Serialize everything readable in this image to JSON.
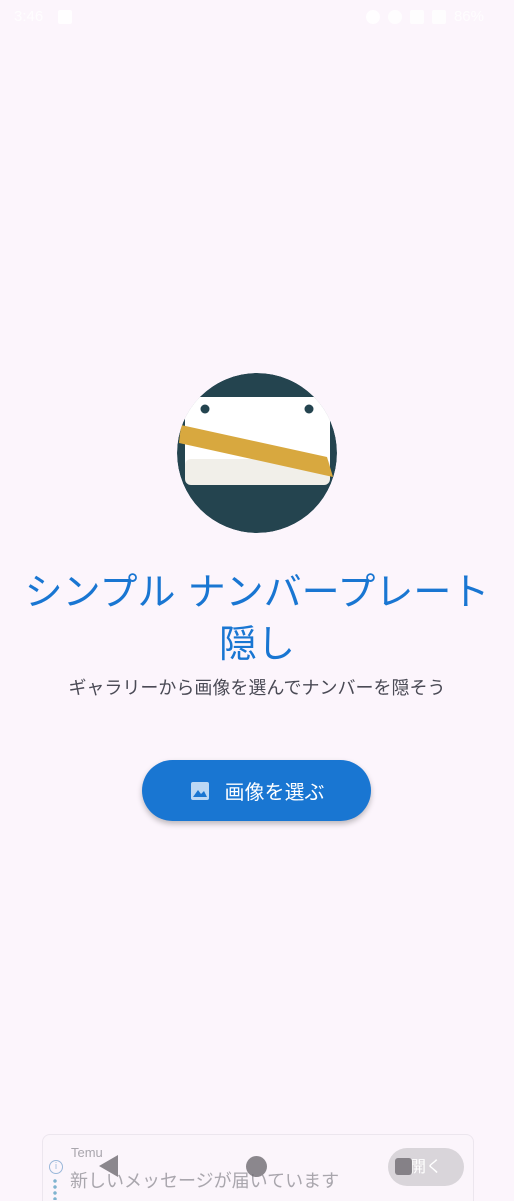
{
  "status_bar": {
    "time": "3:46",
    "battery": "86%"
  },
  "hero": {
    "icon": "license-plate-icon",
    "colors": {
      "circle": "#24444f",
      "plate": "#ffffff",
      "tape": "#d8a83f"
    }
  },
  "main": {
    "title": "シンプル ナンバープレート隠し",
    "subtitle": "ギャラリーから画像を選んでナンバーを隠そう",
    "choose_button": {
      "label": "画像を選ぶ",
      "icon": "image-icon"
    }
  },
  "notification": {
    "app_name": "Temu",
    "message": "新しいメッセージが届いています",
    "open_label": "開く"
  },
  "nav_bar": {
    "back": "back-icon",
    "home": "home-icon",
    "recents": "recents-icon"
  },
  "colors": {
    "background": "#fcf5fc",
    "accent": "#1976d2",
    "subtitle_text": "#4a4a55"
  }
}
